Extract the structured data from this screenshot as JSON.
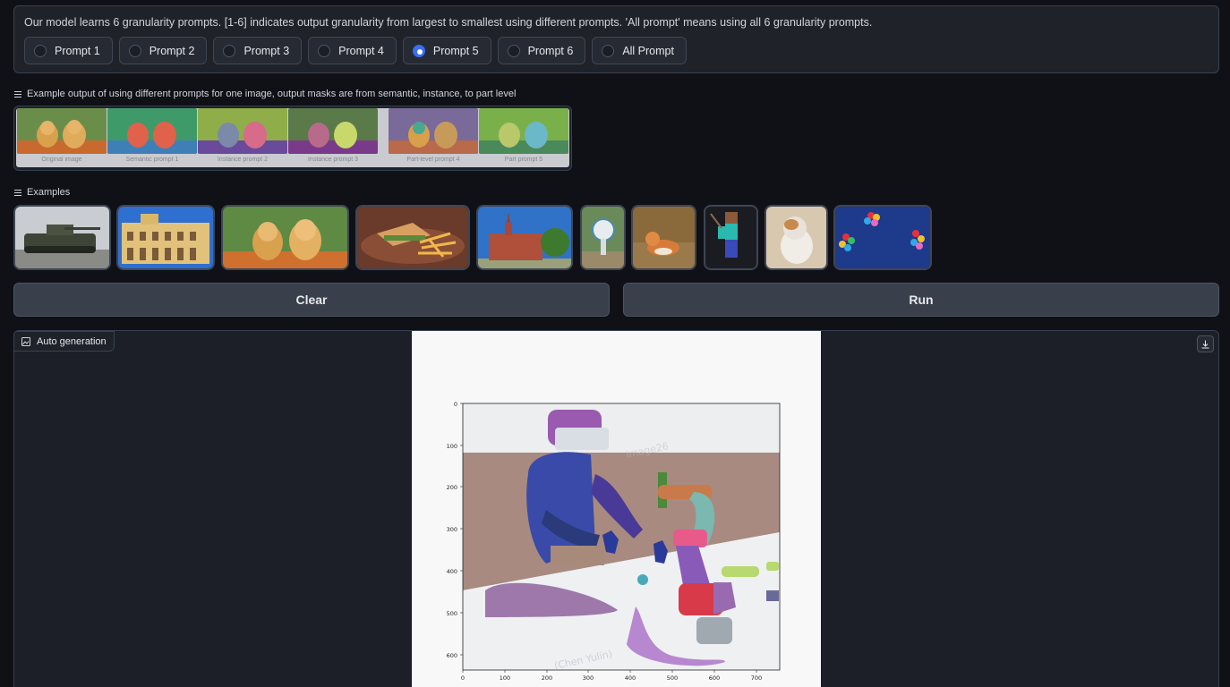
{
  "prompt_panel": {
    "description": "Our model learns 6 granularity prompts. [1-6] indicates output granularity from largest to smallest using different prompts. 'All prompt' means using all 6 granularity prompts.",
    "options": [
      "Prompt 1",
      "Prompt 2",
      "Prompt 3",
      "Prompt 4",
      "Prompt 5",
      "Prompt 6",
      "All Prompt"
    ],
    "selected": "Prompt 5"
  },
  "example_output": {
    "label": "Example output of using different prompts for one image, output masks are from semantic, instance, to part level",
    "captions": [
      "Original image",
      "Semantic prompt 1",
      "Instance prompt 2",
      "Instance prompt 3",
      "Part-level prompt 4",
      "Part prompt 5"
    ]
  },
  "examples": {
    "label": "Examples",
    "items": [
      "tank-image",
      "building-image",
      "puppies-image",
      "sandwich-image",
      "church-image",
      "statue-image",
      "corgi-image",
      "minecraft-image",
      "cat-image",
      "balloons-image"
    ]
  },
  "buttons": {
    "clear": "Clear",
    "run": "Run"
  },
  "output": {
    "tag": "Auto generation",
    "watermark": "(Chen Yulin)",
    "watermark2": "Image26",
    "x_ticks": [
      "0",
      "100",
      "200",
      "300",
      "400",
      "500",
      "600",
      "700"
    ],
    "y_ticks": [
      "0",
      "100",
      "200",
      "300",
      "400",
      "500",
      "600"
    ]
  },
  "colors": {
    "accent": "#3b6df2",
    "panel": "#1f2229",
    "background": "#0f1117"
  }
}
